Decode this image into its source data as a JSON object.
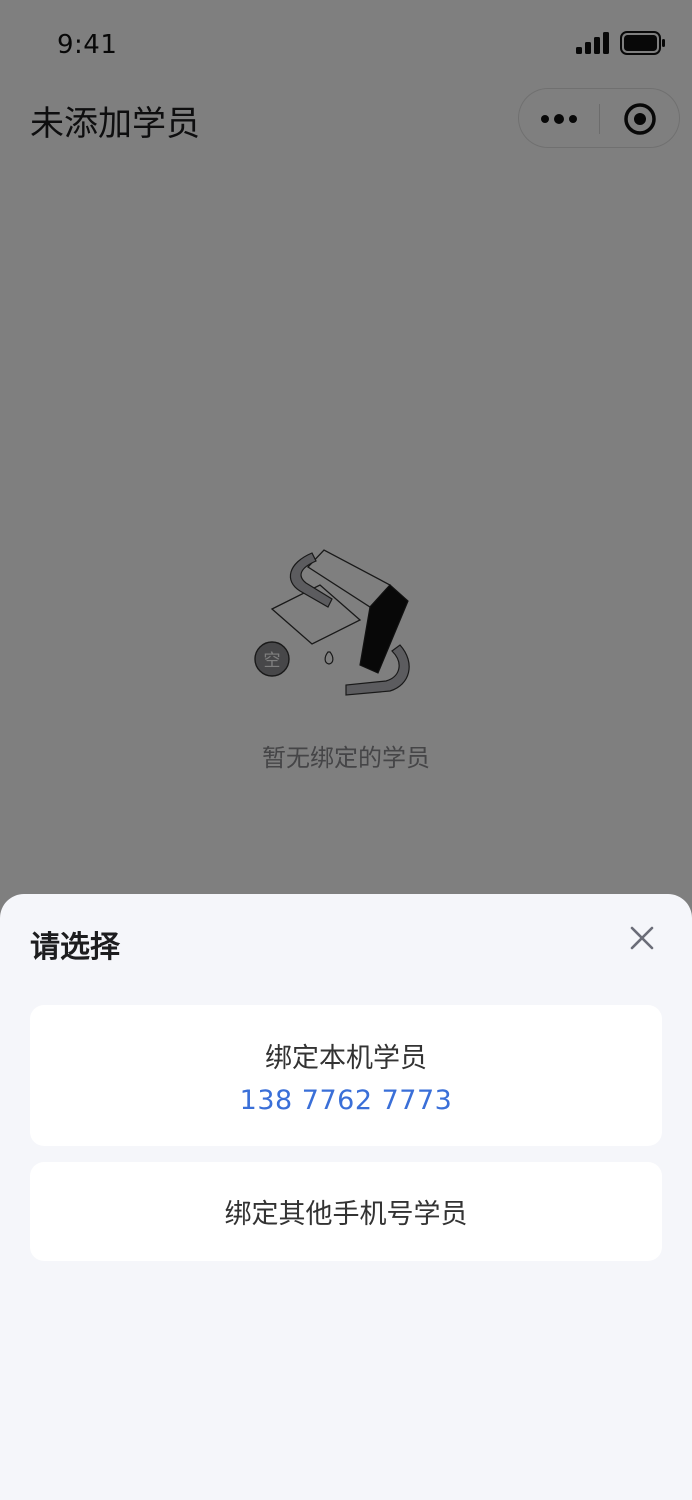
{
  "status_bar": {
    "time": "9:41"
  },
  "nav": {
    "title": "未添加学员"
  },
  "empty_state": {
    "badge": "空",
    "text": "暂无绑定的学员"
  },
  "sheet": {
    "title": "请选择",
    "options": [
      {
        "label": "绑定本机学员",
        "phone": "138 7762 7773"
      },
      {
        "label": "绑定其他手机号学员"
      }
    ]
  },
  "colors": {
    "accent_blue": "#3a6fd8",
    "sheet_background": "#f5f6fa",
    "mask": "rgba(0,0,0,0.5)"
  },
  "icons": [
    "signal-icon",
    "battery-icon",
    "more-icon",
    "target-icon",
    "close-icon"
  ]
}
